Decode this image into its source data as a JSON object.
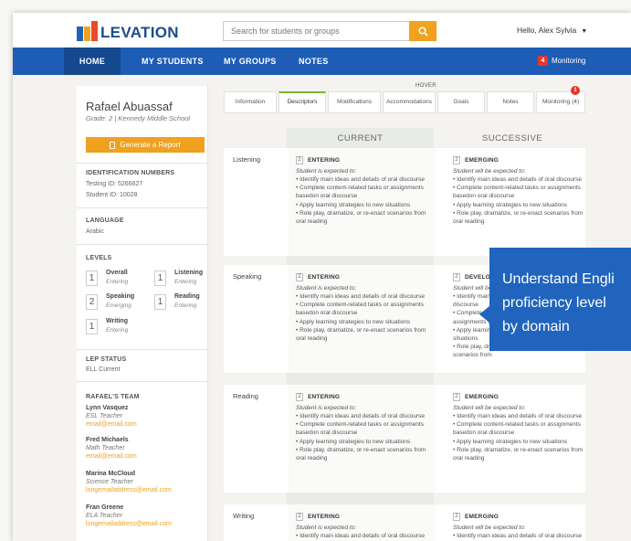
{
  "logo": {
    "text": "LEVATION",
    "marks": [
      "E",
      "L"
    ]
  },
  "search": {
    "placeholder": "Search for students or groups"
  },
  "user": {
    "label": "Hello, Alex Sylvia"
  },
  "nav": {
    "items": [
      "HOME",
      "MY STUDENTS",
      "MY GROUPS",
      "NOTES"
    ],
    "monitoring_count": "4",
    "monitoring_label": "Monitoring"
  },
  "student": {
    "name": "Rafael Abuassaf",
    "grade": "Grade: 2  |  Kennedy Middle School",
    "report_button": "Generate a Report",
    "id_heading": "IDENTIFICATION NUMBERS",
    "testing_id": "Testing ID: 5266627",
    "student_id": "Student ID: 10028",
    "language_heading": "LANGUAGE",
    "language": "Arabic",
    "levels_heading": "LEVELS",
    "levels": [
      {
        "num": "1",
        "name": "Overall",
        "status": "Entering"
      },
      {
        "num": "1",
        "name": "Listening",
        "status": "Entering"
      },
      {
        "num": "2",
        "name": "Speaking",
        "status": "Emerging"
      },
      {
        "num": "1",
        "name": "Reading",
        "status": "Entering"
      },
      {
        "num": "1",
        "name": "Writing",
        "status": "Entering"
      }
    ],
    "lep_heading": "LEP STATUS",
    "lep": "ELL Current",
    "team_heading": "RAFAEL'S TEAM",
    "team": [
      {
        "name": "Lynn Vasquez",
        "role": "ESL Teacher",
        "email": "email@email.com"
      },
      {
        "name": "Fred Michaels",
        "role": "Math Teacher",
        "email": "email@email.com"
      },
      {
        "name": "Marina McCloud",
        "role": "Science Teacher",
        "email": "longemailaddress@email.com"
      },
      {
        "name": "Fran Greene",
        "role": "ELA Teacher",
        "email": "longemailaddress@email.com"
      }
    ]
  },
  "tabs": {
    "hover_label": "HOVER",
    "alert_count": "1",
    "items": [
      "Information",
      "Descriptors",
      "Modifications",
      "Accommodations",
      "Goals",
      "Notes",
      "Monitoring (4)"
    ],
    "active": "Descriptors"
  },
  "columns": {
    "current": "CURRENT",
    "successive": "SUCCESSIVE"
  },
  "rows": [
    {
      "domain": "Listening",
      "current": {
        "num": "2",
        "level": "ENTERING",
        "expected": "Student is expected to:",
        "desc": "• Identify main ideas and details of oral discourse\n• Complete content-related tasks or assignments basedon oral discourse\n• Apply learning strategies to new situations\n• Role play, dramatize, or re-enact scenarios from oral reading"
      },
      "successive": {
        "num": "2",
        "level": "EMERGING",
        "expected": "Student will be expected to:",
        "desc": "• Identify main ideas and details of oral discourse\n• Complete content-related tasks or assignments basedon oral discourse\n• Apply learning strategies to new situations\n• Role play, dramatize, or re-enact scenarios from oral reading"
      }
    },
    {
      "domain": "Speaking",
      "current": {
        "num": "2",
        "level": "ENTERING",
        "expected": "Student is expected to:",
        "desc": "• Identify main ideas and details of oral discourse\n• Complete content-related tasks or assignments basedon oral discourse\n• Apply learning strategies to new situations\n• Role play, dramatize, or re-enact scenarios from oral reading"
      },
      "successive": {
        "num": "2",
        "level": "DEVELOP",
        "expected": "Student will be",
        "desc": "• Identify main\ndiscourse\n• Complete co\nassignments b\n• Apply learnin\nsituations\n• Role play, dra\nscenarios from"
      }
    },
    {
      "domain": "Reading",
      "current": {
        "num": "2",
        "level": "ENTERING",
        "expected": "Student is expected to:",
        "desc": "• Identify main ideas and details of oral discourse\n• Complete content-related tasks or assignments basedon oral discourse\n• Apply learning strategies to new situations\n• Role play, dramatize, or re-enact scenarios from oral reading"
      },
      "successive": {
        "num": "2",
        "level": "EMERGING",
        "expected": "Student will be expected to:",
        "desc": "• Identify main ideas and details of oral discourse\n• Complete content-related tasks or assignments basedon oral discourse\n• Apply learning strategies to new situations\n• Role play, dramatize, or re-enact scenarios from oral reading"
      }
    },
    {
      "domain": "Writing",
      "current": {
        "num": "2",
        "level": "ENTERING",
        "expected": "Student is expected to:",
        "desc": "• Identify main ideas and details of oral discourse"
      },
      "successive": {
        "num": "2",
        "level": "EMERGING",
        "expected": "Student will be expected to:",
        "desc": "• Identify main ideas and details of oral discourse"
      }
    }
  ],
  "callout": {
    "text": "Understand Engli\nproficiency level\nby domain"
  },
  "colors": {
    "brand_blue": "#1d5db5",
    "accent_orange": "#f0a11e",
    "alert_red": "#e8352a",
    "active_green": "#76b82a"
  }
}
